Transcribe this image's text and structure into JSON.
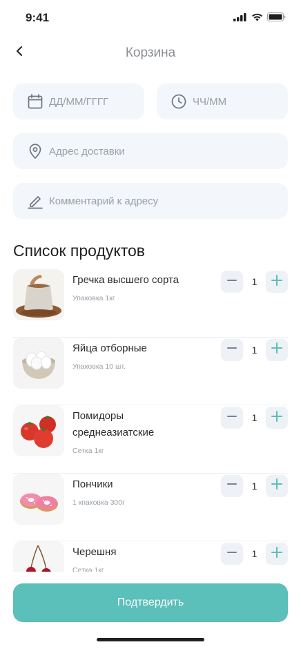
{
  "status_bar": {
    "time": "9:41"
  },
  "header": {
    "title": "Корзина"
  },
  "form": {
    "date_placeholder": "ДД/ММ/ГГГГ",
    "time_placeholder": "ЧЧ/ММ",
    "address_placeholder": "Адрес доставки",
    "comment_placeholder": "Комментарий к адресу"
  },
  "products": {
    "title": "Список продуктов",
    "items": [
      {
        "name": "Гречка высшего сорта",
        "pack": "Упаковка 1кг",
        "qty": "1",
        "image": "buckwheat-sack-image"
      },
      {
        "name": "Яйца отборные",
        "pack": "Упаковка 10 шт.",
        "qty": "1",
        "image": "eggs-bowl-image"
      },
      {
        "name": "Помидоры среднеазиатские",
        "pack": "Сетка 1кг",
        "qty": "1",
        "image": "tomatoes-image"
      },
      {
        "name": "Пончики",
        "pack": "1 кпаковка 300г",
        "qty": "1",
        "image": "donuts-image"
      },
      {
        "name": "Черешня",
        "pack": "Сетка 1кг",
        "qty": "1",
        "image": "cherries-image"
      }
    ]
  },
  "confirm_label": "Подтвердить",
  "colors": {
    "accent": "#5bbfba",
    "field_bg": "#f3f6fa",
    "muted_text": "#9aa0a8"
  }
}
